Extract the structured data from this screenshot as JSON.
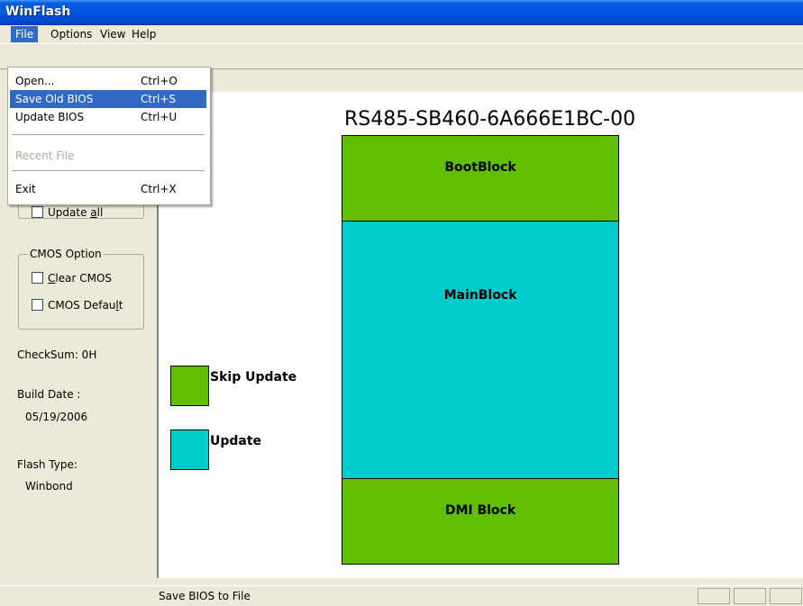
{
  "window": {
    "title": "WinFlash"
  },
  "menubar": {
    "file": "File",
    "options": "Options",
    "view": "View",
    "help": "Help"
  },
  "file_menu": {
    "open": {
      "label": "Open...",
      "shortcut": "Ctrl+O"
    },
    "save_old_bios": {
      "label": "Save Old BIOS",
      "shortcut": "Ctrl+S"
    },
    "update_bios": {
      "label": "Update BIOS",
      "shortcut": "Ctrl+U"
    },
    "recent_file": {
      "label": "Recent File"
    },
    "exit": {
      "label": "Exit",
      "shortcut": "Ctrl+X"
    }
  },
  "left_panel": {
    "update_all": {
      "pre": "",
      "accel": "",
      "label_pre": "Update ",
      "label_accel": "a",
      "label_post": "ll"
    },
    "cmos_group": {
      "caption": "CMOS Option"
    },
    "clear_cmos": {
      "accel": "C",
      "rest": "lear CMOS"
    },
    "cmos_default": {
      "pre": "CMOS Defau",
      "accel": "l",
      "post": "t"
    },
    "checksum": "CheckSum:  0H",
    "build_date_label": "Build Date :",
    "build_date_value": "05/19/2006",
    "flash_type_label": "Flash Type:",
    "flash_type_value": "Winbond"
  },
  "bios_map": {
    "title": "RS485-SB460-6A666E1BC-00",
    "blocks": {
      "boot": {
        "label": "BootBlock",
        "color": "#5fbf00"
      },
      "main": {
        "label": "MainBlock",
        "color": "#00cccc"
      },
      "dmi": {
        "label": "DMI Block",
        "color": "#5fbf00"
      }
    },
    "legend": {
      "skip": {
        "label": "Skip Update",
        "color": "#5fbf00"
      },
      "update": {
        "label": "Update",
        "color": "#00cccc"
      }
    }
  },
  "status_bar": {
    "text": "Save BIOS to File"
  }
}
